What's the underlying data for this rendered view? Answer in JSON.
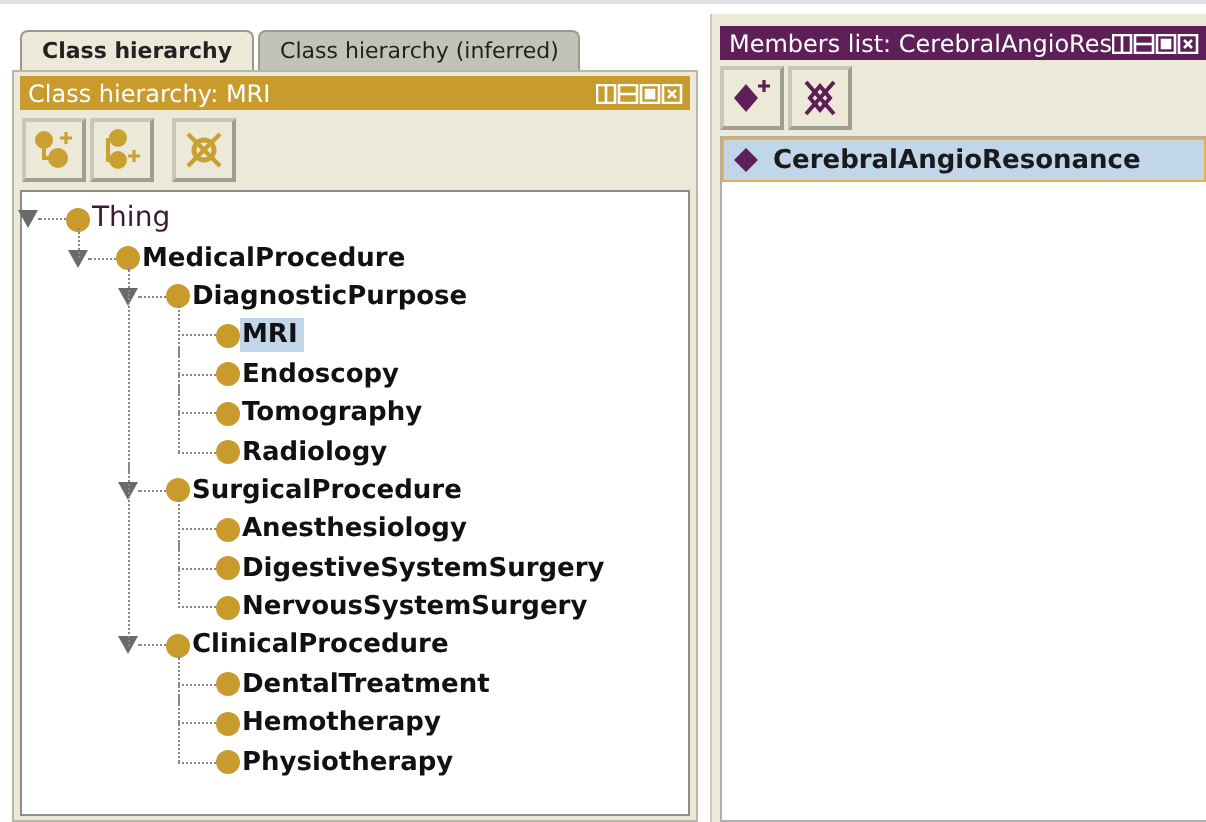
{
  "tabs": [
    {
      "label": "Class hierarchy",
      "selected": true
    },
    {
      "label": "Class hierarchy (inferred)",
      "selected": false
    }
  ],
  "hierarchy_view": {
    "title": "Class hierarchy: MRI",
    "tree": [
      {
        "label": "Thing",
        "bold": false,
        "selected": false,
        "expanded": true,
        "children": [
          {
            "label": "MedicalProcedure",
            "bold": true,
            "selected": false,
            "expanded": true,
            "children": [
              {
                "label": "DiagnosticPurpose",
                "bold": true,
                "selected": false,
                "expanded": true,
                "children": [
                  {
                    "label": "MRI",
                    "bold": true,
                    "selected": true
                  },
                  {
                    "label": "Endoscopy",
                    "bold": true,
                    "selected": false
                  },
                  {
                    "label": "Tomography",
                    "bold": true,
                    "selected": false
                  },
                  {
                    "label": "Radiology",
                    "bold": true,
                    "selected": false
                  }
                ]
              },
              {
                "label": "SurgicalProcedure",
                "bold": true,
                "selected": false,
                "expanded": true,
                "children": [
                  {
                    "label": "Anesthesiology",
                    "bold": true,
                    "selected": false
                  },
                  {
                    "label": "DigestiveSystemSurgery",
                    "bold": true,
                    "selected": false
                  },
                  {
                    "label": "NervousSystemSurgery",
                    "bold": true,
                    "selected": false
                  }
                ]
              },
              {
                "label": "ClinicalProcedure",
                "bold": true,
                "selected": false,
                "expanded": true,
                "children": [
                  {
                    "label": "DentalTreatment",
                    "bold": true,
                    "selected": false
                  },
                  {
                    "label": "Hemotherapy",
                    "bold": true,
                    "selected": false
                  },
                  {
                    "label": "Physiotherapy",
                    "bold": true,
                    "selected": false
                  }
                ]
              }
            ]
          }
        ]
      }
    ]
  },
  "members_view": {
    "title": "Members list: CerebralAngioRes",
    "items": [
      {
        "label": "CerebralAngioResonance",
        "selected": true
      }
    ]
  }
}
